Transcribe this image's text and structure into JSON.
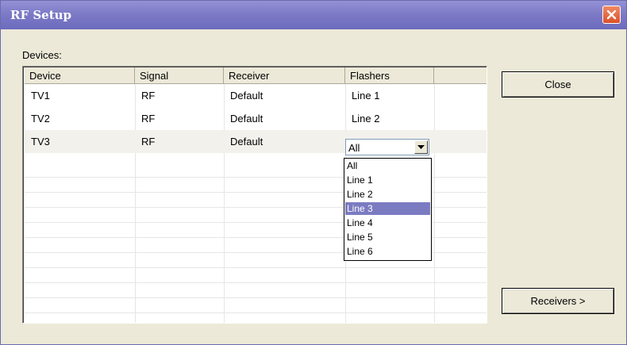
{
  "window": {
    "title": "RF Setup"
  },
  "devices": {
    "label": "Devices:",
    "columns": [
      "Device",
      "Signal",
      "Receiver",
      "Flashers",
      ""
    ],
    "rows": [
      {
        "device": "TV1",
        "signal": "RF",
        "receiver": "Default",
        "flashers": "Line 1"
      },
      {
        "device": "TV2",
        "signal": "RF",
        "receiver": "Default",
        "flashers": "Line 2"
      },
      {
        "device": "TV3",
        "signal": "RF",
        "receiver": "Default",
        "flashers": "All"
      }
    ]
  },
  "flashers_dropdown": {
    "selected": "All",
    "options": [
      "All",
      "Line 1",
      "Line 2",
      "Line 3",
      "Line 4",
      "Line 5",
      "Line 6"
    ],
    "highlighted": "Line 3"
  },
  "buttons": {
    "close": "Close",
    "receivers": "Receivers >"
  },
  "colors": {
    "titlebar": "#7d7bc7",
    "highlight": "#7b7bc2",
    "close_button": "#e06a40"
  }
}
